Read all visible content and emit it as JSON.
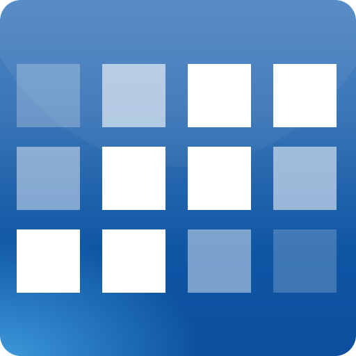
{
  "icon": {
    "name": "calendar-grid-app-icon",
    "colors": {
      "top": "#4f86c2",
      "bottom": "#0b4f9e",
      "glow": "#50b4f0",
      "tile": "#ffffff"
    },
    "tiles": [
      {
        "opacity": 0.25
      },
      {
        "opacity": 0.6
      },
      {
        "opacity": 1.0
      },
      {
        "opacity": 1.0
      },
      {
        "opacity": 0.45
      },
      {
        "opacity": 1.0
      },
      {
        "opacity": 1.0
      },
      {
        "opacity": 0.55
      },
      {
        "opacity": 1.0
      },
      {
        "opacity": 1.0
      },
      {
        "opacity": 0.45
      },
      {
        "opacity": 0.2
      }
    ]
  }
}
